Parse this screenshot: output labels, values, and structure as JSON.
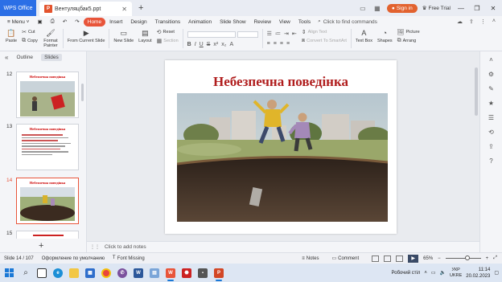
{
  "titlebar": {
    "app_tab": "WPS Office",
    "doc_tab": "Вентуляцбак5.ppt",
    "signin": "Sign in",
    "free_trial": "Free Trial"
  },
  "menubar": {
    "menu_label": "Menu",
    "items": [
      "Home",
      "Insert",
      "Design",
      "Transitions",
      "Animation",
      "Slide Show",
      "Review",
      "View",
      "Tools"
    ],
    "active_item": "Home",
    "search_placeholder": "Click to find commands"
  },
  "ribbon": {
    "paste": "Paste",
    "cut": "Cut",
    "copy": "Copy",
    "format_painter": "Format Painter",
    "from_current_slide": "From Current Slide",
    "new_slide": "New Slide",
    "layout": "Layout",
    "reset": "Reset",
    "section": "Section",
    "align_text": "Align Text",
    "convert_to_smartart": "Convert To SmartArt",
    "text_box": "Text Box",
    "shapes": "Shapes",
    "picture": "Picture",
    "arrange": "Arrang"
  },
  "leftpane": {
    "tab_outline": "Outline",
    "tab_slides": "Slides",
    "thumbs": [
      {
        "num": "12",
        "title": "Небезпечна поведінка"
      },
      {
        "num": "13",
        "title": "Небезпечна поведінка"
      },
      {
        "num": "14",
        "title": "Небезпечна поведінка"
      },
      {
        "num": "15",
        "title": ""
      }
    ],
    "selected_slide": "14"
  },
  "slide": {
    "title": "Небезпечна поведінка"
  },
  "notes": {
    "placeholder": "Click to add notes"
  },
  "statusbar": {
    "slide_counter": "Slide 14 / 107",
    "theme": "Оформление по умолчанию",
    "font_missing": "Font Missing",
    "notes": "Notes",
    "comment": "Comment",
    "zoom": "65%"
  },
  "taskbar": {
    "weather": "Робочий стіл",
    "lang_top": "УКР",
    "lang_bottom": "UKRE",
    "time": "11:14",
    "date": "20.02.2023"
  },
  "colors": {
    "accent": "#e8553a",
    "wps_blue": "#2b6fe6",
    "slide_title_red": "#b01d1d"
  }
}
